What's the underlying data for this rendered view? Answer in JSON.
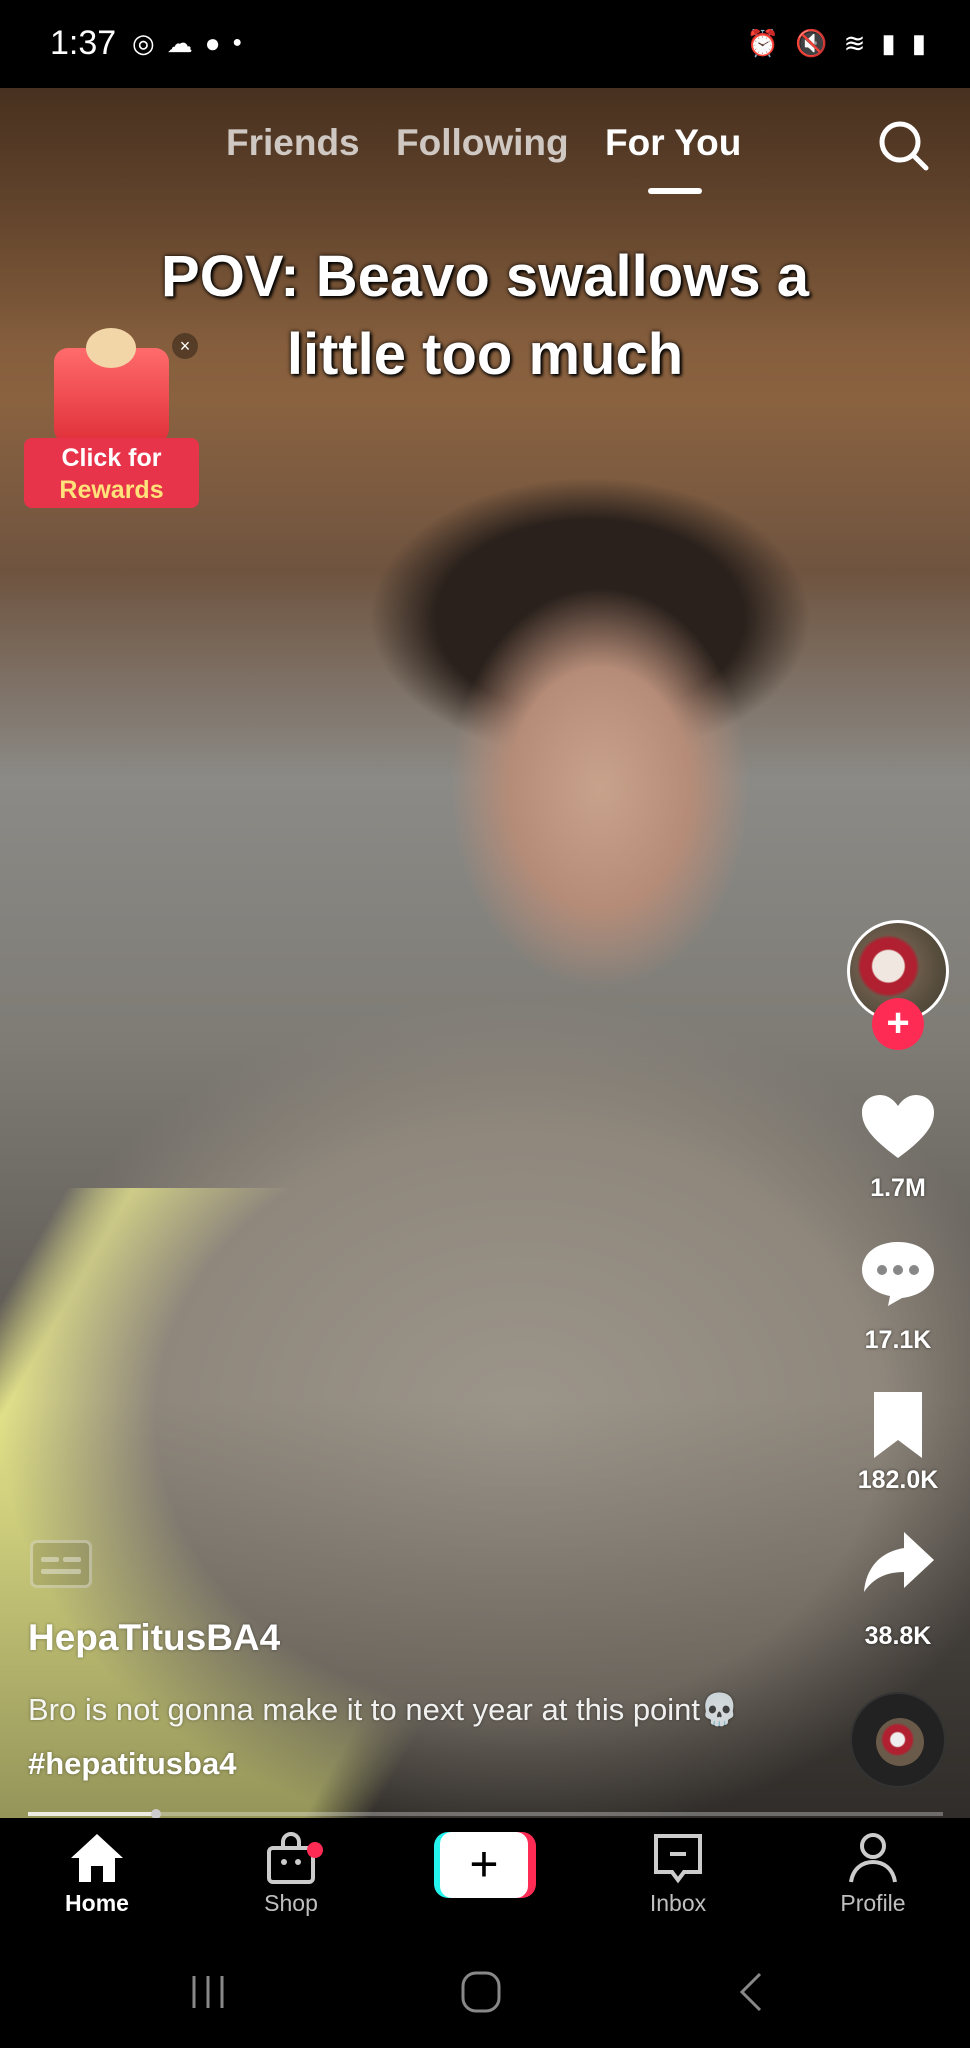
{
  "status_bar": {
    "time": "1:37",
    "left_icons": [
      "instagram-icon",
      "cloud-sync-icon",
      "messenger-icon",
      "dot-icon"
    ],
    "right_icons": [
      "alarm-icon",
      "mute-icon",
      "wifi-icon",
      "signal-icon",
      "battery-icon"
    ]
  },
  "top_tabs": [
    {
      "label": "Friends",
      "active": false
    },
    {
      "label": "Following",
      "active": false
    },
    {
      "label": "For You",
      "active": true
    }
  ],
  "video": {
    "overlay_text_line1": "POV: Beavo swallows a",
    "overlay_text_line2": "little too much",
    "progress_percent": 14
  },
  "reward": {
    "line1": "Click for",
    "line2": "Rewards",
    "close": "×"
  },
  "actions": {
    "likes": "1.7M",
    "comments": "17.1K",
    "saves": "182.0K",
    "shares": "38.8K",
    "follow": "+"
  },
  "post": {
    "username": "HepaTitusBA4",
    "description": "Bro is not gonna make it to next year at this point💀",
    "hashtag": "#hepatitusba4"
  },
  "bottom_nav": [
    {
      "label": "Home",
      "active": true
    },
    {
      "label": "Shop",
      "badge": true
    },
    {
      "label": "+",
      "create": true
    },
    {
      "label": "Inbox"
    },
    {
      "label": "Profile"
    }
  ],
  "colors": {
    "accent": "#fe2c55",
    "cyan": "#25f4ee"
  }
}
